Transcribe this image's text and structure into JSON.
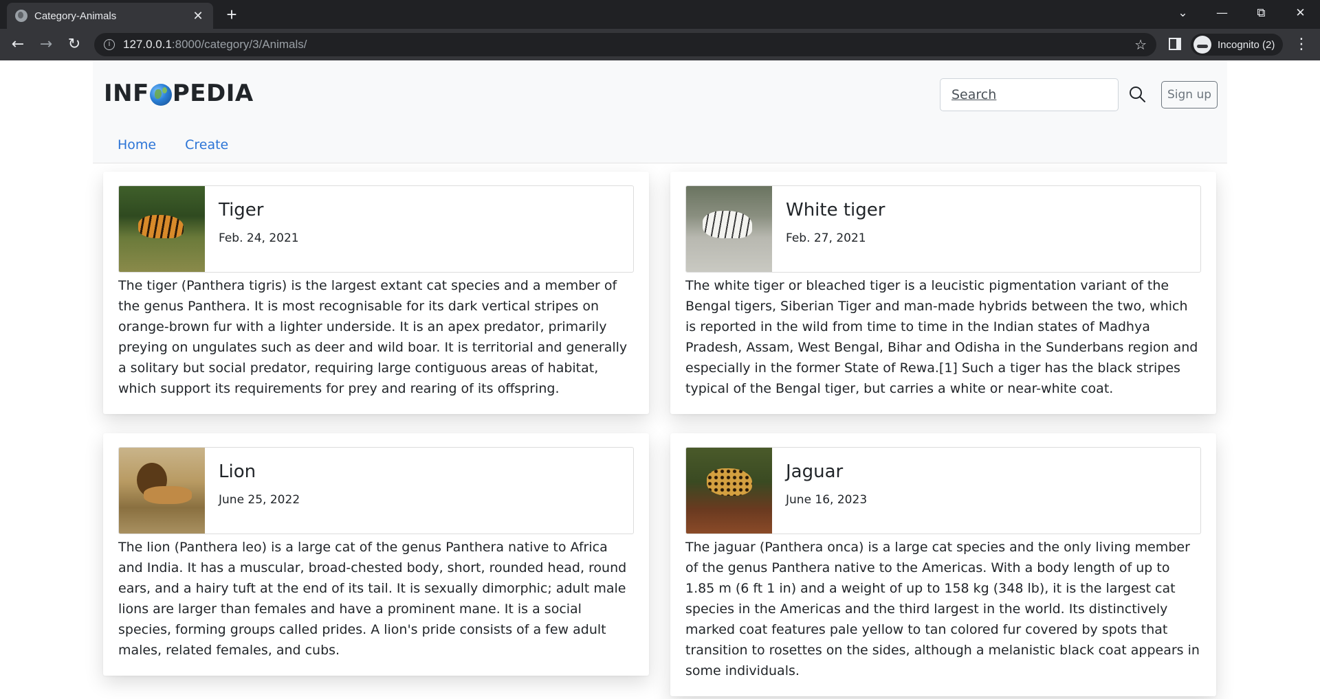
{
  "browser": {
    "tab_title": "Category-Animals",
    "url_host": "127.0.0.1",
    "url_path": ":8000/category/3/Animals/",
    "profile_label": "Incognito (2)",
    "icons": {
      "back": "←",
      "forward": "→",
      "reload": "↻",
      "info": "i",
      "star": "☆",
      "menu": "⋮",
      "close_tab": "✕",
      "new_tab": "+",
      "tab_search": "⌄",
      "minimize": "—",
      "restore": "⧉",
      "close_window": "✕"
    }
  },
  "navbar": {
    "brand_left": "INF",
    "brand_right": "PEDIA",
    "search_placeholder": "Search",
    "signup_label": "Sign up",
    "links": [
      "Home",
      "Create"
    ]
  },
  "articles": [
    {
      "title": "Tiger",
      "date": "Feb. 24, 2021",
      "body": "The tiger (Panthera tigris) is the largest extant cat species and a member of the genus Panthera. It is most recognisable for its dark vertical stripes on orange-brown fur with a lighter underside. It is an apex predator, primarily preying on ungulates such as deer and wild boar. It is territorial and generally a solitary but social predator, requiring large contiguous areas of habitat, which support its requirements for prey and rearing of its offspring."
    },
    {
      "title": "White tiger",
      "date": "Feb. 27, 2021",
      "body": "The white tiger or bleached tiger is a leucistic pigmentation variant of the Bengal tigers, Siberian Tiger and man-made hybrids between the two, which is reported in the wild from time to time in the Indian states of Madhya Pradesh, Assam, West Bengal, Bihar and Odisha in the Sunderbans region and especially in the former State of Rewa.[1] Such a tiger has the black stripes typical of the Bengal tiger, but carries a white or near-white coat."
    },
    {
      "title": "Lion",
      "date": "June 25, 2022",
      "body": "The lion (Panthera leo) is a large cat of the genus Panthera native to Africa and India. It has a muscular, broad-chested body, short, rounded head, round ears, and a hairy tuft at the end of its tail. It is sexually dimorphic; adult male lions are larger than females and have a prominent mane. It is a social species, forming groups called prides. A lion's pride consists of a few adult males, related females, and cubs."
    },
    {
      "title": "Jaguar",
      "date": "June 16, 2023",
      "body": "The jaguar (Panthera onca) is a large cat species and the only living member of the genus Panthera native to the Americas. With a body length of up to 1.85 m (6 ft 1 in) and a weight of up to 158 kg (348 lb), it is the largest cat species in the Americas and the third largest in the world. Its distinctively marked coat features pale yellow to tan colored fur covered by spots that transition to rosettes on the sides, although a melanistic black coat appears in some individuals."
    }
  ],
  "colors": {
    "link": "#2b74d6",
    "navbar_bg": "#f8f9fa",
    "chrome_dark": "#202124",
    "chrome_toolbar": "#35363a"
  }
}
